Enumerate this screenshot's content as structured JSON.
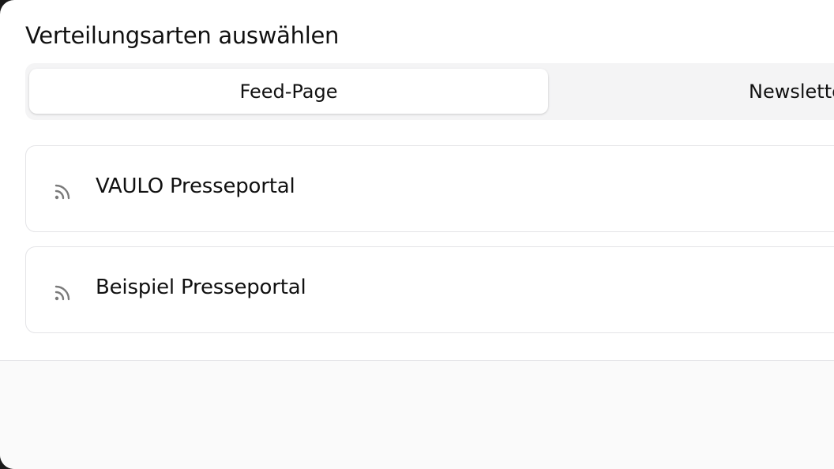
{
  "dialog": {
    "title": "Verteilungsarten auswählen"
  },
  "tabs": [
    {
      "label": "Feed-Page",
      "active": true
    },
    {
      "label": "Newsletter",
      "active": false
    }
  ],
  "items": [
    {
      "label": "VAULO Presseportal",
      "icon": "rss-icon"
    },
    {
      "label": "Beispiel Presseportal",
      "icon": "rss-icon"
    }
  ],
  "colors": {
    "background": "#ffffff",
    "tab_track": "#f4f4f5",
    "border": "#e4e4e7",
    "footer": "#fafafa",
    "icon": "#7a7a7a",
    "text": "#111111"
  }
}
